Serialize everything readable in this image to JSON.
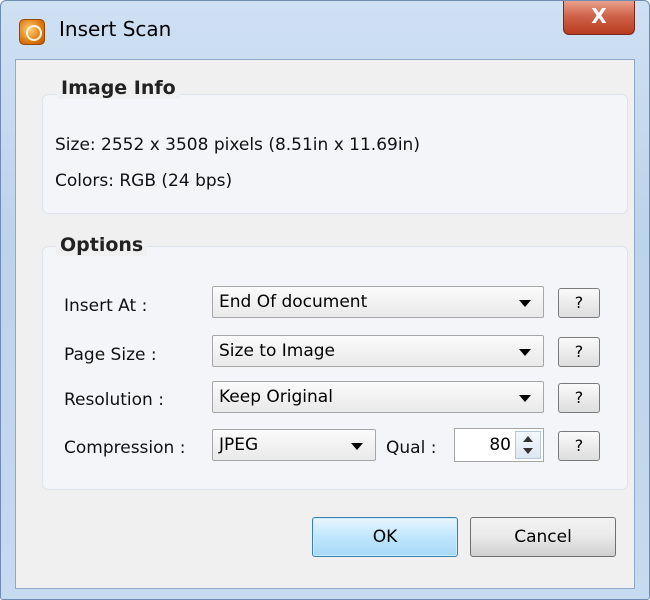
{
  "window": {
    "title": "Insert Scan",
    "close_label": "X"
  },
  "image_info": {
    "heading": "Image Info",
    "size_line": "Size: 2552 x 3508 pixels (8.51in x 11.69in)",
    "colors_line": "Colors: RGB (24 bps)"
  },
  "options": {
    "heading": "Options",
    "insert_at": {
      "label": "Insert At :",
      "value": "End Of document",
      "help": "?"
    },
    "page_size": {
      "label": "Page Size :",
      "value": "Size to Image",
      "help": "?"
    },
    "resolution": {
      "label": "Resolution :",
      "value": "Keep Original",
      "help": "?"
    },
    "compression": {
      "label": "Compression :",
      "value": "JPEG",
      "help": "?"
    },
    "quality": {
      "label": "Qual :",
      "value": "80"
    }
  },
  "buttons": {
    "ok": "OK",
    "cancel": "Cancel"
  }
}
